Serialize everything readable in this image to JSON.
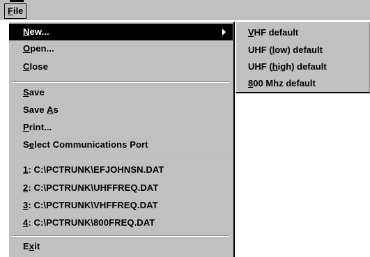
{
  "menubar": {
    "file": {
      "pre": "",
      "key": "F",
      "post": "ile"
    }
  },
  "file_menu": {
    "new": {
      "pre": "",
      "key": "N",
      "post": "ew..."
    },
    "open": {
      "pre": "",
      "key": "O",
      "post": "pen..."
    },
    "close": {
      "pre": "",
      "key": "C",
      "post": "lose"
    },
    "save": {
      "pre": "",
      "key": "S",
      "post": "ave"
    },
    "save_as": {
      "pre": "Save ",
      "key": "A",
      "post": "s"
    },
    "print": {
      "pre": "",
      "key": "P",
      "post": "rint..."
    },
    "select_port": {
      "pre": "S",
      "key": "e",
      "post": "lect Communications Port"
    },
    "recent": [
      {
        "key": "1",
        "post": ": C:\\PCTRUNK\\EFJOHNSN.DAT"
      },
      {
        "key": "2",
        "post": ": C:\\PCTRUNK\\UHFFREQ.DAT"
      },
      {
        "key": "3",
        "post": ": C:\\PCTRUNK\\VHFFREQ.DAT"
      },
      {
        "key": "4",
        "post": ": C:\\PCTRUNK\\800FREQ.DAT"
      }
    ],
    "exit": {
      "pre": "E",
      "key": "x",
      "post": "it"
    }
  },
  "new_submenu": {
    "vhf": {
      "pre": "",
      "key": "V",
      "post": "HF default"
    },
    "uhf_low": {
      "pre": "UHF (",
      "key": "l",
      "post": "ow) default"
    },
    "uhf_high": {
      "pre": "UHF (",
      "key": "h",
      "post": "igh) default"
    },
    "mhz800": {
      "pre": "",
      "key": "8",
      "post": "00 Mhz default"
    }
  },
  "icons": {
    "submenu_arrow": "triangle-right"
  }
}
